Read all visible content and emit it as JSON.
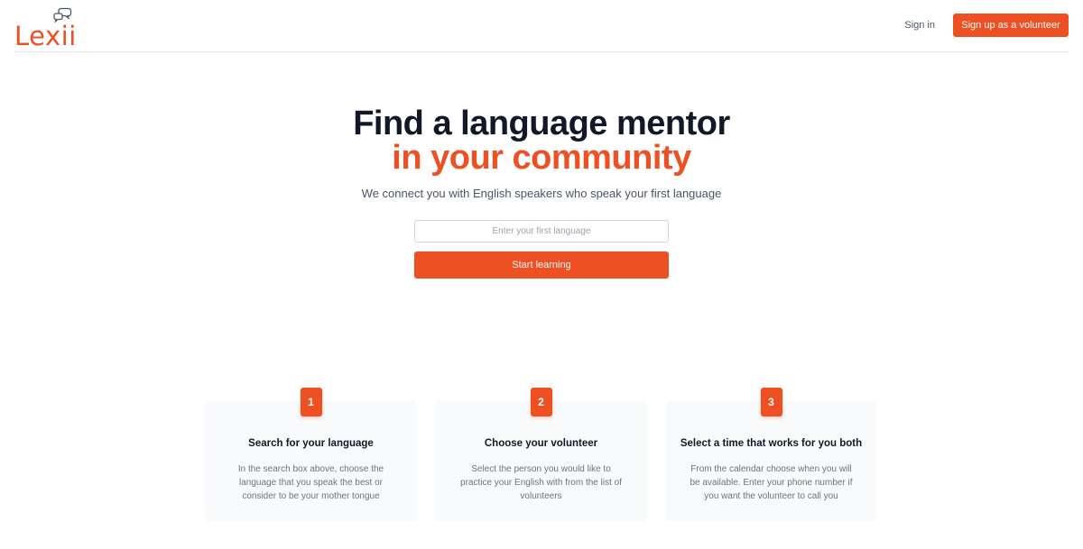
{
  "header": {
    "logo_text": "Lexii",
    "signin_label": "Sign in",
    "signup_label": "Sign up as a volunteer"
  },
  "hero": {
    "title": "Find a language mentor",
    "title_accent": "in your community",
    "subtitle": "We connect you with English speakers who speak your first language",
    "input_placeholder": "Enter your first language",
    "input_value": "",
    "button_label": "Start learning"
  },
  "steps": [
    {
      "number": "1",
      "title": "Search for your language",
      "text": "In the search box above, choose the language that you speak the best or consider to be your mother tongue"
    },
    {
      "number": "2",
      "title": "Choose your volunteer",
      "text": "Select the person you would like to practice your English with from the list of volunteers"
    },
    {
      "number": "3",
      "title": "Select a time that works for you both",
      "text": "From the calendar choose when you will be available. Enter your phone number if you want the volunteer to call you"
    }
  ],
  "colors": {
    "accent": "#ef5023",
    "text_dark": "#111827",
    "text_muted": "#6b7280",
    "card_bg": "#f9fafb"
  },
  "icons": {
    "logo_mark": "chat-bubbles-icon"
  }
}
